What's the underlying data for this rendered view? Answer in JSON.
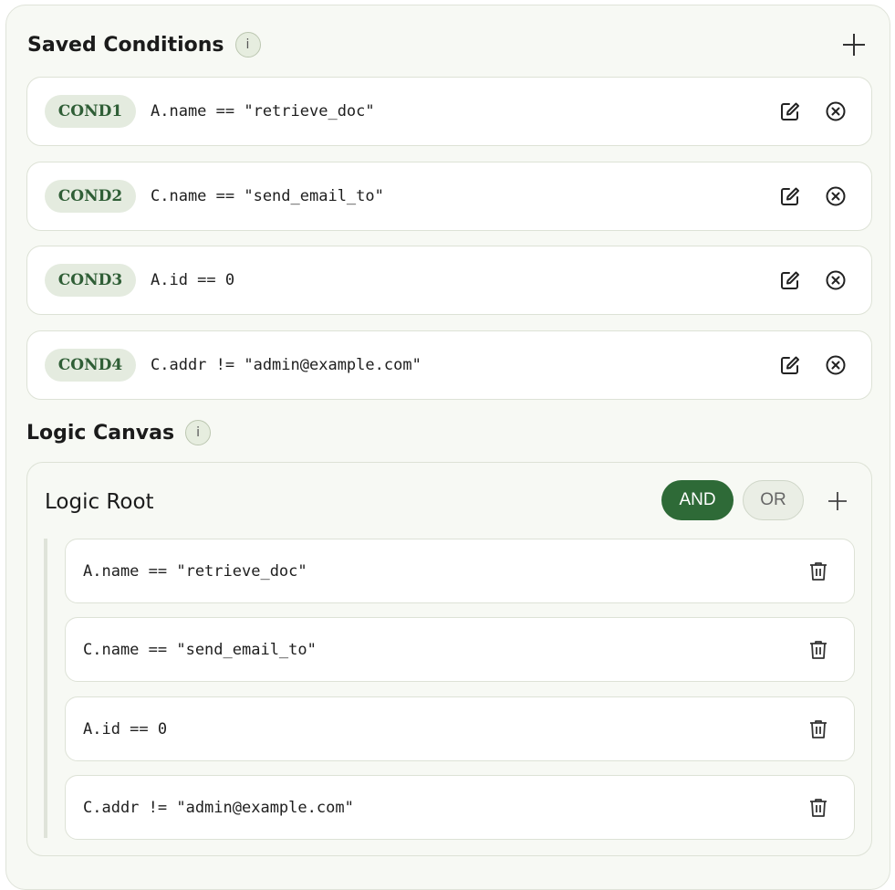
{
  "saved_conditions": {
    "title": "Saved Conditions",
    "info_label": "i",
    "items": [
      {
        "id": "COND1",
        "expr": "A.name == \"retrieve_doc\""
      },
      {
        "id": "COND2",
        "expr": "C.name == \"send_email_to\""
      },
      {
        "id": "COND3",
        "expr": "A.id == 0"
      },
      {
        "id": "COND4",
        "expr": "C.addr != \"admin@example.com\""
      }
    ]
  },
  "logic_canvas": {
    "title": "Logic Canvas",
    "info_label": "i",
    "root": {
      "title": "Logic Root",
      "and_label": "AND",
      "or_label": "OR",
      "selected_operator": "AND",
      "items": [
        {
          "expr": "A.name == \"retrieve_doc\""
        },
        {
          "expr": "C.name == \"send_email_to\""
        },
        {
          "expr": "A.id == 0"
        },
        {
          "expr": "C.addr != \"admin@example.com\""
        }
      ]
    }
  },
  "colors": {
    "accent": "#2e6a37",
    "pill_bg": "#e4ebdf",
    "pill_text": "#2f5e36",
    "panel_bg": "#f7f9f4"
  },
  "icons": {
    "add": "plus-icon",
    "edit": "edit-icon",
    "remove": "close-circle-icon",
    "delete": "trash-icon",
    "info": "info-icon"
  }
}
